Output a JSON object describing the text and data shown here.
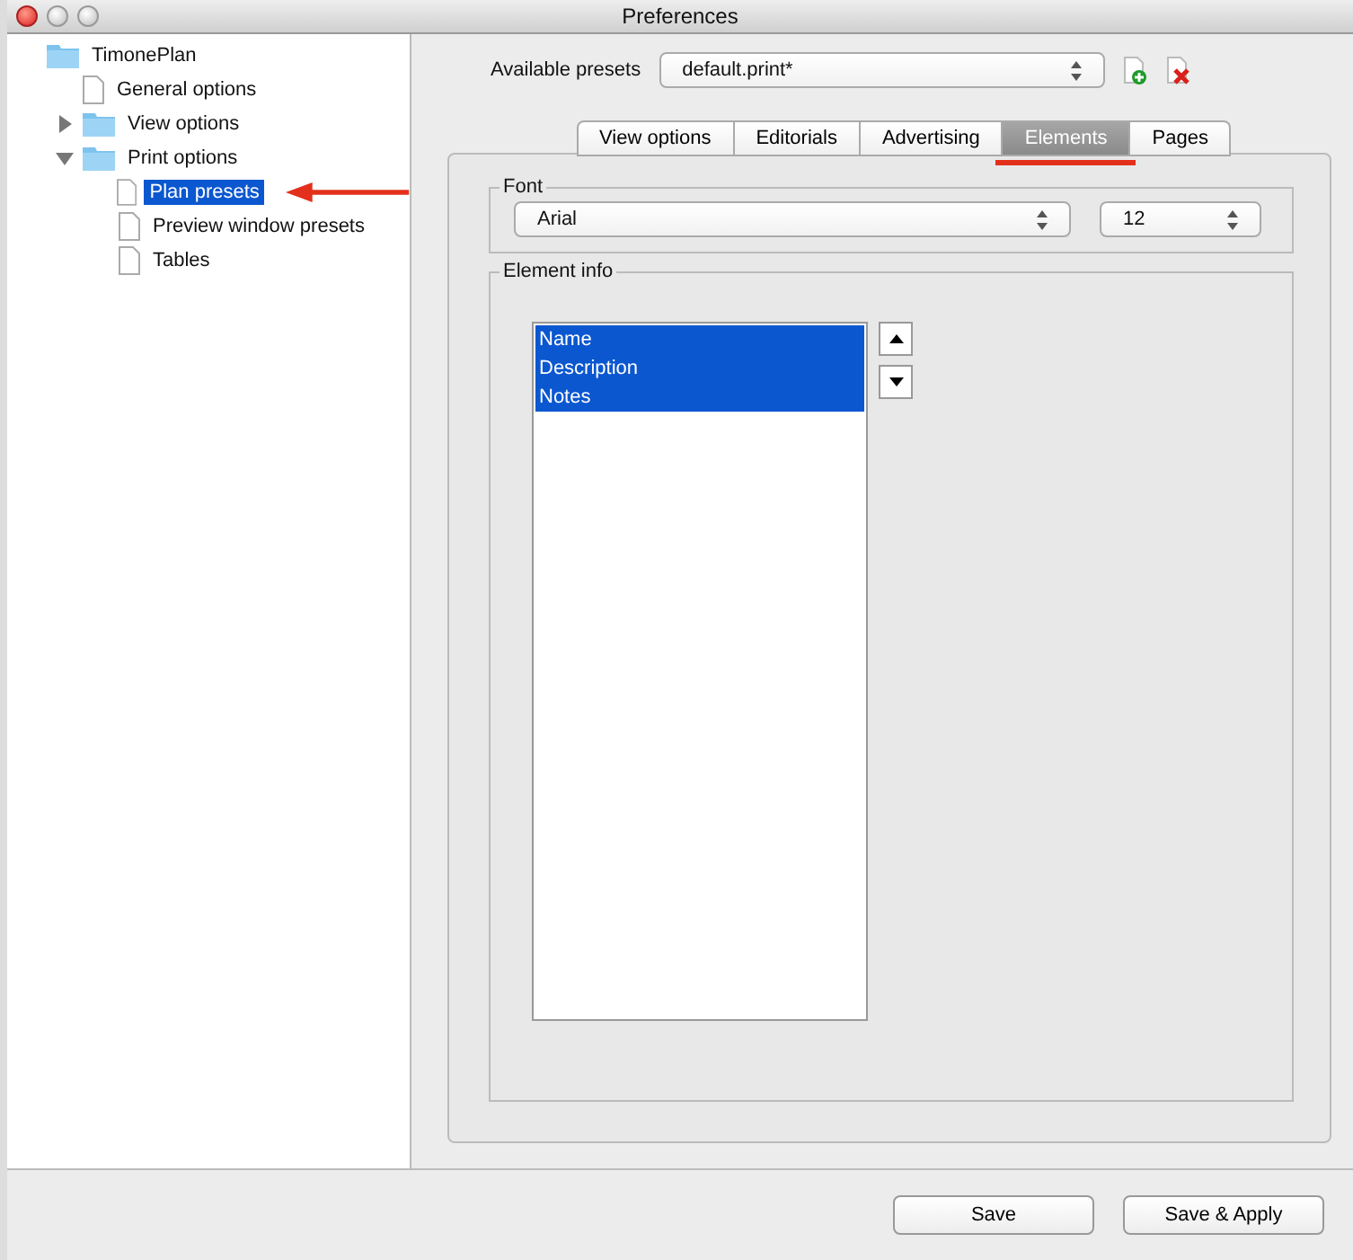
{
  "window": {
    "title": "Preferences"
  },
  "tree": [
    {
      "label": "TimonePlan",
      "kind": "folder",
      "selected": false,
      "children": [
        {
          "label": "General options",
          "kind": "page",
          "selected": false
        },
        {
          "label": "View options",
          "kind": "folder",
          "expanded": false,
          "selected": false
        },
        {
          "label": "Print options",
          "kind": "folder",
          "expanded": true,
          "selected": false,
          "children": [
            {
              "label": "Plan presets",
              "kind": "page",
              "selected": true
            },
            {
              "label": "Preview window presets",
              "kind": "page",
              "selected": false
            },
            {
              "label": "Tables",
              "kind": "page",
              "selected": false
            }
          ]
        }
      ]
    }
  ],
  "presets": {
    "label": "Available presets",
    "value": "default.print*"
  },
  "tabs": [
    {
      "label": "View options",
      "selected": false
    },
    {
      "label": "Editorials",
      "selected": false
    },
    {
      "label": "Advertising",
      "selected": false
    },
    {
      "label": "Elements",
      "selected": true
    },
    {
      "label": "Pages",
      "selected": false
    }
  ],
  "font": {
    "legend": "Font",
    "family": "Arial",
    "size": "12"
  },
  "element_info": {
    "legend": "Element info",
    "items": [
      {
        "label": "Name",
        "selected": true
      },
      {
        "label": "Description",
        "selected": true
      },
      {
        "label": "Notes",
        "selected": true
      }
    ]
  },
  "buttons": [
    "Save",
    "Save & Apply"
  ]
}
